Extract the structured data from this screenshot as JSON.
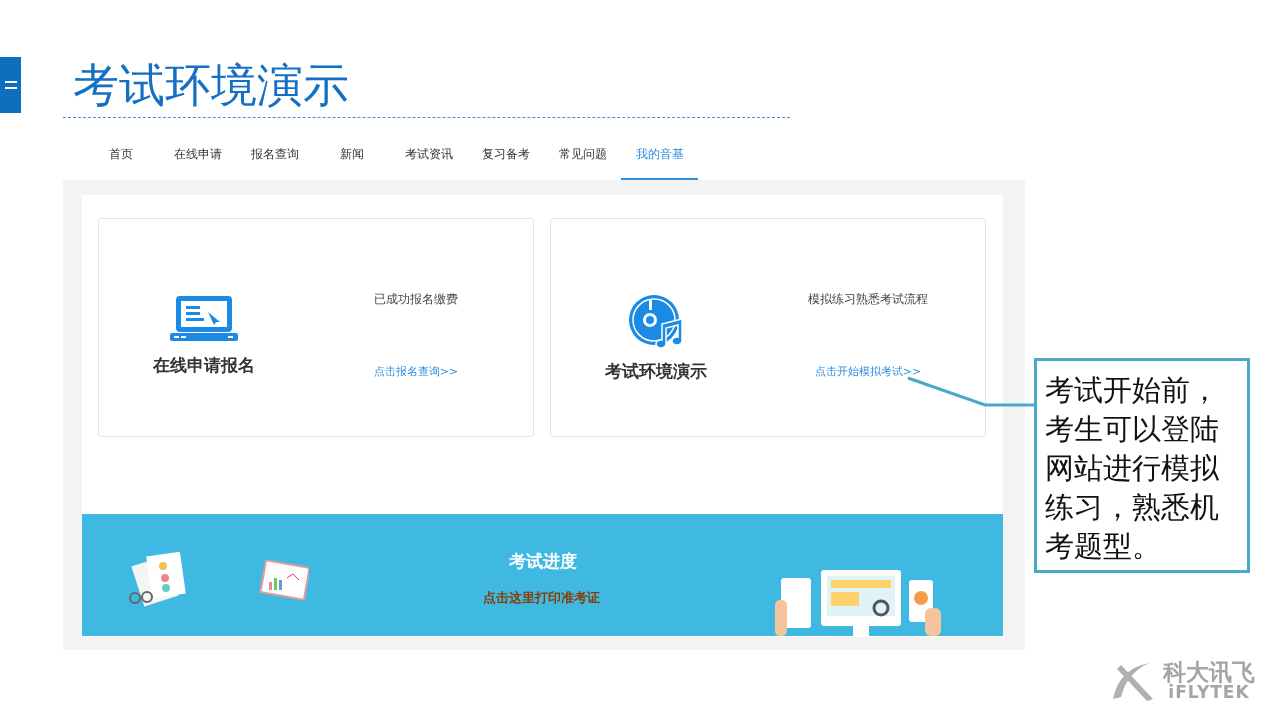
{
  "slide_title": "考试环境演示",
  "nav": [
    {
      "label": "首页",
      "selected": false
    },
    {
      "label": "在线申请",
      "selected": false
    },
    {
      "label": "报名查询",
      "selected": false
    },
    {
      "label": "新闻",
      "selected": false
    },
    {
      "label": "考试资讯",
      "selected": false
    },
    {
      "label": "复习备考",
      "selected": false
    },
    {
      "label": "常见问题",
      "selected": false
    },
    {
      "label": "我的音基",
      "selected": true
    }
  ],
  "cards": [
    {
      "kind": "laptop",
      "title": "在线申请报名",
      "description": "已成功报名缴费",
      "link": "点击报名查询>>"
    },
    {
      "kind": "disc",
      "title": "考试环境演示",
      "description": "模拟练习熟悉考试流程",
      "link": "点击开始模拟考试>>"
    }
  ],
  "banner": {
    "title": "考试进度",
    "link": "点击这里打印准考证"
  },
  "callout": "考试开始前，考生可以登陆网站进行模拟练习，熟悉机考题型。",
  "logo": {
    "name": "科大讯飞",
    "brand": "iFLYTEK"
  }
}
